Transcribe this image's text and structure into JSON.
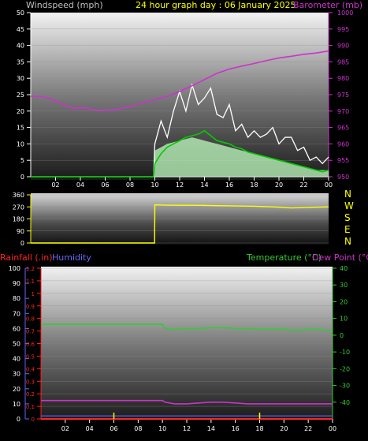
{
  "header": {
    "windspeed_label": "Windspeed (mph)",
    "title": "24 hour graph day : 06 January 2025",
    "barometer_label": "Barometer (mb)"
  },
  "compass": [
    "N",
    "W",
    "S",
    "E",
    "N"
  ],
  "legend2": {
    "rainfall": "Rainfall (.in)",
    "humidity": "Humidity",
    "temperature": "Temperature (°C)",
    "dewpoint": "Dew Point (°C)"
  },
  "colors": {
    "windspeed_label": "#c0c0c0",
    "title": "#ffff00",
    "barometer": "#cc33cc",
    "gust": "#ffffff",
    "avg_wind": "#00cc00",
    "wind_fill": "#b8f0b8",
    "direction": "#ffff00",
    "rainfall": "#ff2222",
    "humidity": "#6666ff",
    "temperature": "#33cc33",
    "dewpoint": "#cc33cc",
    "tick_green": "#33cc33",
    "tick_yellow": "#ffff00"
  },
  "chart_data": [
    {
      "type": "line",
      "title": "24 hour graph day : 06 January 2025",
      "xlabel": "",
      "x_tick_labels": [
        "02",
        "04",
        "06",
        "08",
        "10",
        "12",
        "14",
        "16",
        "18",
        "20",
        "22",
        "00"
      ],
      "xlim_hours": [
        0,
        24
      ],
      "ylabel": "Windspeed (mph)",
      "ylim": [
        0,
        50
      ],
      "y_ticks": [
        0,
        5,
        10,
        15,
        20,
        25,
        30,
        35,
        40,
        45,
        50
      ],
      "y2label": "Barometer (mb)",
      "y2lim": [
        950,
        1000
      ],
      "y2_ticks": [
        950,
        955,
        960,
        965,
        970,
        975,
        980,
        985,
        990,
        995,
        1000
      ],
      "series": [
        {
          "name": "Barometer (mb)",
          "axis": "right",
          "x": [
            0,
            1,
            2,
            2.5,
            3,
            3.5,
            4,
            4.5,
            5,
            5.5,
            6,
            6.5,
            7,
            8,
            9,
            10,
            11,
            12,
            13,
            14,
            15,
            16,
            17,
            18,
            19,
            20,
            21,
            22,
            23,
            24
          ],
          "values": [
            974.5,
            974.4,
            973.2,
            972.2,
            971.3,
            970.8,
            971,
            970.9,
            970.4,
            970.2,
            970.3,
            970.4,
            970.6,
            971.3,
            972.5,
            973.5,
            974.5,
            976,
            977.7,
            979.6,
            981.5,
            982.8,
            983.7,
            984.5,
            985.4,
            986.2,
            986.7,
            987.3,
            987.7,
            988.3
          ]
        },
        {
          "name": "Gust",
          "axis": "left",
          "x": [
            0,
            9.9,
            10,
            10.5,
            11,
            11.5,
            12,
            12.5,
            13,
            13.5,
            14,
            14.5,
            15,
            15.5,
            16,
            16.5,
            17,
            17.5,
            18,
            18.5,
            19,
            19.5,
            20,
            20.5,
            21,
            21.5,
            22,
            22.5,
            23,
            23.5,
            24
          ],
          "values": [
            0,
            0,
            10,
            17,
            12,
            20,
            26,
            20,
            28,
            22,
            24,
            27,
            19,
            18,
            22,
            14,
            16,
            12,
            14,
            12,
            13,
            15,
            10,
            12,
            12,
            8,
            9,
            5,
            6,
            4,
            6
          ]
        },
        {
          "name": "Average wind",
          "axis": "left",
          "x": [
            0,
            9.9,
            10,
            10.5,
            11,
            11.5,
            12,
            12.5,
            13,
            13.5,
            14,
            14.5,
            15,
            15.5,
            16,
            16.5,
            17,
            17.5,
            18,
            18.5,
            19,
            19.5,
            20,
            20.5,
            21,
            21.5,
            22,
            22.5,
            23,
            23.5,
            24
          ],
          "values": [
            0,
            0,
            4,
            7,
            9,
            10,
            11,
            12,
            12.5,
            13,
            14,
            12.5,
            11,
            10.5,
            10,
            9,
            8.5,
            7.5,
            7,
            6.5,
            6,
            5.5,
            5,
            4.5,
            4,
            3.5,
            3,
            2.5,
            2,
            1.5,
            2
          ]
        },
        {
          "name": "Wind range",
          "axis": "left",
          "x": [
            0,
            9.9,
            10,
            11,
            12,
            13,
            14,
            15,
            16,
            17,
            18,
            19,
            20,
            21,
            22,
            23,
            24
          ],
          "values": [
            0,
            0,
            8,
            10,
            11,
            12,
            11,
            10,
            9,
            8,
            7,
            6,
            5,
            4,
            3,
            2,
            2
          ]
        }
      ]
    },
    {
      "type": "line",
      "title": "",
      "ylabel": "",
      "ylim": [
        0,
        360
      ],
      "y_ticks": [
        0,
        90,
        180,
        270,
        360
      ],
      "xlim_hours": [
        0,
        24
      ],
      "series": [
        {
          "name": "Wind direction",
          "x": [
            0,
            9.98,
            10,
            11,
            12,
            13,
            14,
            15,
            16,
            17,
            18,
            19,
            20,
            21,
            22,
            23,
            24
          ],
          "values": [
            0,
            0,
            285,
            283,
            282,
            282,
            281,
            279,
            278,
            276,
            275,
            272,
            268,
            262,
            265,
            268,
            270
          ]
        }
      ]
    },
    {
      "type": "line",
      "title": "",
      "x_tick_labels": [
        "02",
        "04",
        "06",
        "08",
        "10",
        "12",
        "14",
        "16",
        "18",
        "20",
        "22",
        "00"
      ],
      "xlim_hours": [
        0,
        24
      ],
      "ylabel": "Rainfall (.in)",
      "ylim": [
        0,
        1.2
      ],
      "y_ticks_rain": [
        0,
        0.1,
        0.2,
        0.3,
        0.4,
        0.5,
        0.6,
        0.7,
        0.8,
        0.9,
        1,
        1.1,
        1.2
      ],
      "y_ticks_humidity": [
        0,
        10,
        20,
        30,
        40,
        50,
        60,
        70,
        80,
        90,
        100
      ],
      "y2label": "Temperature (°C)",
      "y2lim": [
        -50,
        40
      ],
      "y2_ticks": [
        -40,
        -30,
        -20,
        -10,
        0,
        10,
        20,
        30,
        40
      ],
      "series": [
        {
          "name": "Temperature (°C)",
          "axis": "right",
          "x": [
            0,
            10,
            10.2,
            11,
            12,
            13,
            14,
            15,
            16,
            17,
            18,
            19,
            20,
            21,
            22,
            23,
            24
          ],
          "values": [
            6.5,
            6.5,
            4,
            3.5,
            4,
            4,
            4.5,
            4.5,
            4,
            4,
            3.5,
            3.5,
            3.5,
            3,
            3.5,
            3.5,
            2.5
          ]
        },
        {
          "name": "Dew Point (°C)",
          "axis": "right",
          "x": [
            0,
            10,
            10.2,
            11,
            12,
            13,
            14,
            15,
            16,
            17,
            18,
            19,
            20,
            21,
            22,
            23,
            24
          ],
          "values": [
            -39,
            -39,
            -40,
            -41,
            -41,
            -40.5,
            -40,
            -40,
            -40.5,
            -41,
            -41,
            -41,
            -41,
            -41,
            -41,
            -41,
            -41
          ]
        },
        {
          "name": "Humidity",
          "axis": "humidity",
          "x": [
            0,
            24
          ],
          "values": [
            2,
            2
          ]
        },
        {
          "name": "Rainfall (.in)",
          "axis": "left",
          "x": [
            0,
            24
          ],
          "values": [
            0,
            0
          ]
        },
        {
          "name": "Rain marks",
          "axis": "left",
          "x": [
            6,
            18
          ],
          "values": [
            0.05,
            0.05
          ]
        }
      ]
    }
  ]
}
